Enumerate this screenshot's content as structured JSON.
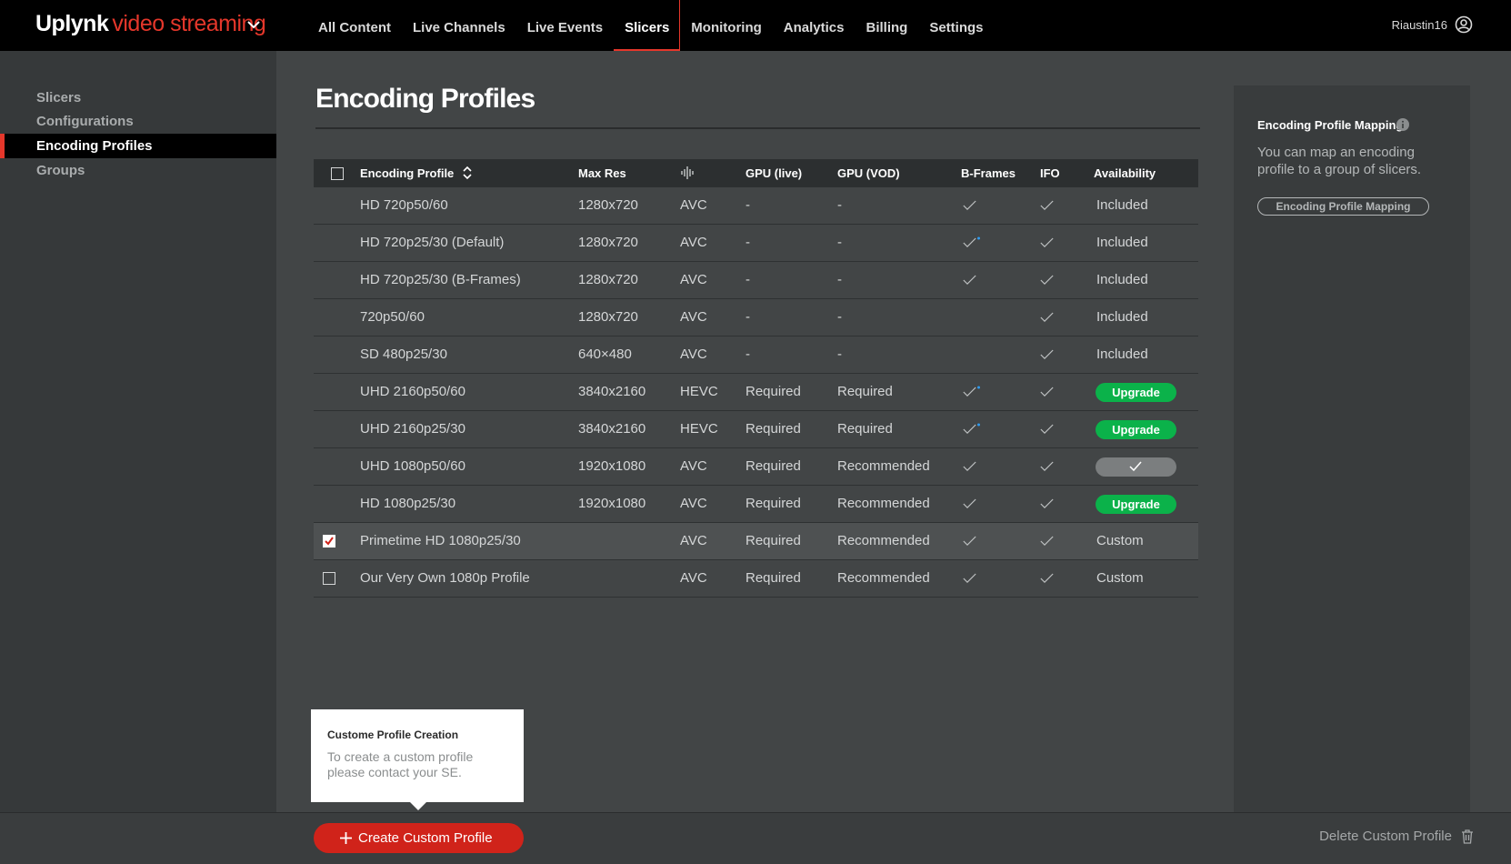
{
  "header": {
    "brand": "Uplynk",
    "product": "video streaming",
    "nav": [
      {
        "label": "All Content"
      },
      {
        "label": "Live Channels"
      },
      {
        "label": "Live Events"
      },
      {
        "label": "Slicers",
        "active": true
      },
      {
        "label": "Monitoring"
      },
      {
        "label": "Analytics"
      },
      {
        "label": "Billing"
      },
      {
        "label": "Settings"
      }
    ],
    "username": "Riaustin16"
  },
  "sidebar": {
    "items": [
      {
        "label": "Slicers"
      },
      {
        "label": "Configurations"
      },
      {
        "label": "Encoding Profiles",
        "active": true
      },
      {
        "label": "Groups"
      }
    ]
  },
  "main": {
    "title": "Encoding Profiles",
    "table": {
      "columns": {
        "profile": "Encoding Profile",
        "max_res": "Max Res",
        "codec_icon": "codec-waveform-icon",
        "gpu_live": "GPU (live)",
        "gpu_vod": "GPU (VOD)",
        "bframes": "B-Frames",
        "ifo": "IFO",
        "availability": "Availability"
      },
      "rows": [
        {
          "name": "HD 720p50/60",
          "res": "1280x720",
          "codec": "AVC",
          "gpu_live": "-",
          "gpu_vod": "-",
          "bframes": "check",
          "ifo": "check",
          "availability": "Included",
          "checkbox": "none"
        },
        {
          "name": "HD 720p25/30 (Default)",
          "res": "1280x720",
          "codec": "AVC",
          "gpu_live": "-",
          "gpu_vod": "-",
          "bframes": "check-star",
          "ifo": "check",
          "availability": "Included",
          "checkbox": "none"
        },
        {
          "name": "HD 720p25/30 (B-Frames)",
          "res": "1280x720",
          "codec": "AVC",
          "gpu_live": "-",
          "gpu_vod": "-",
          "bframes": "check",
          "ifo": "check",
          "availability": "Included",
          "checkbox": "none"
        },
        {
          "name": "720p50/60",
          "res": "1280x720",
          "codec": "AVC",
          "gpu_live": "-",
          "gpu_vod": "-",
          "bframes": "none",
          "ifo": "check",
          "availability": "Included",
          "checkbox": "none"
        },
        {
          "name": "SD 480p25/30",
          "res": "640×480",
          "codec": "AVC",
          "gpu_live": "-",
          "gpu_vod": "-",
          "bframes": "none",
          "ifo": "check",
          "availability": "Included",
          "checkbox": "none"
        },
        {
          "name": "UHD 2160p50/60",
          "res": "3840x2160",
          "codec": "HEVC",
          "gpu_live": "Required",
          "gpu_vod": "Required",
          "bframes": "check-star",
          "ifo": "check",
          "availability": "Upgrade",
          "availability_type": "upgrade",
          "checkbox": "none"
        },
        {
          "name": "UHD 2160p25/30",
          "res": "3840x2160",
          "codec": "HEVC",
          "gpu_live": "Required",
          "gpu_vod": "Required",
          "bframes": "check-star",
          "ifo": "check",
          "availability": "Upgrade",
          "availability_type": "upgrade",
          "checkbox": "none"
        },
        {
          "name": "UHD 1080p50/60",
          "res": "1920x1080",
          "codec": "AVC",
          "gpu_live": "Required",
          "gpu_vod": "Recommended",
          "bframes": "check",
          "ifo": "check",
          "availability": "",
          "availability_type": "enabled",
          "checkbox": "none"
        },
        {
          "name": "HD 1080p25/30",
          "res": "1920x1080",
          "codec": "AVC",
          "gpu_live": "Required",
          "gpu_vod": "Recommended",
          "bframes": "check",
          "ifo": "check",
          "availability": "Upgrade",
          "availability_type": "upgrade",
          "checkbox": "none"
        },
        {
          "name": "Primetime HD 1080p25/30",
          "res": "",
          "codec": "AVC",
          "gpu_live": "Required",
          "gpu_vod": "Recommended",
          "bframes": "check",
          "ifo": "check",
          "availability": "Custom",
          "checkbox": "checked",
          "selected": true
        },
        {
          "name": "Our Very Own 1080p Profile",
          "res": "",
          "codec": "AVC",
          "gpu_live": "Required",
          "gpu_vod": "Recommended",
          "bframes": "check",
          "ifo": "check",
          "availability": "Custom",
          "checkbox": "unchecked"
        }
      ]
    }
  },
  "panel": {
    "title": "Encoding Profile Mapping",
    "description": "You can map an encoding profile to a group of slicers.",
    "button": "Encoding Profile Mapping"
  },
  "tooltip": {
    "title": "Custome Profile Creation",
    "text": "To create a custom profile please contact your SE."
  },
  "footer": {
    "create_label": "Create Custom Profile",
    "delete_label": "Delete Custom Profile"
  },
  "colors": {
    "accent": "#e5372b",
    "upgrade": "#0bb24a",
    "star": "#2e9bf0"
  }
}
